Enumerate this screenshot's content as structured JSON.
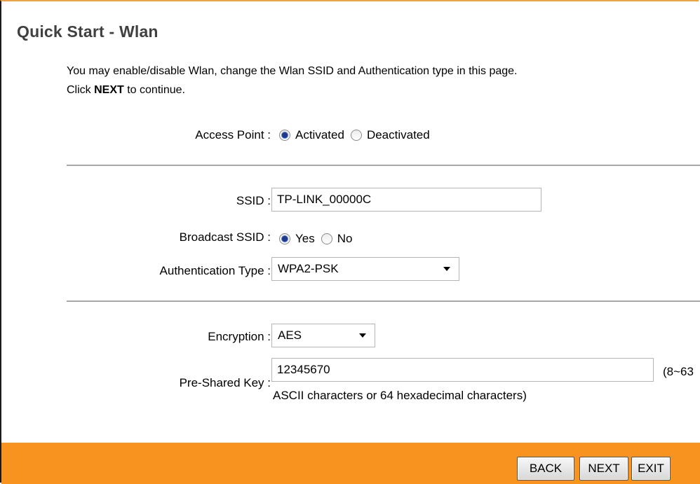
{
  "page": {
    "title": "Quick Start - Wlan",
    "intro_line1": "You may enable/disable Wlan, change the Wlan SSID and Authentication type in this page.",
    "intro_line2_prefix": "Click ",
    "intro_line2_bold": "NEXT",
    "intro_line2_suffix": " to continue."
  },
  "access_point": {
    "label": "Access Point :",
    "options": [
      "Activated",
      "Deactivated"
    ],
    "selected": "Activated"
  },
  "ssid": {
    "label": "SSID :",
    "value": "TP-LINK_00000C"
  },
  "broadcast_ssid": {
    "label": "Broadcast SSID :",
    "options": [
      "Yes",
      "No"
    ],
    "selected": "Yes"
  },
  "authentication": {
    "label": "Authentication Type :",
    "value": "WPA2-PSK"
  },
  "encryption": {
    "label": "Encryption :",
    "value": "AES"
  },
  "psk": {
    "label": "Pre-Shared Key :",
    "value": "12345670",
    "hint_1": "(8~63",
    "hint_2": "ASCII characters or 64 hexadecimal characters)"
  },
  "buttons": {
    "back": "BACK",
    "next": "NEXT",
    "exit": "EXIT"
  },
  "colors": {
    "footer": "#f7931e",
    "title": "#404040",
    "divider": "#a8a8a8"
  }
}
